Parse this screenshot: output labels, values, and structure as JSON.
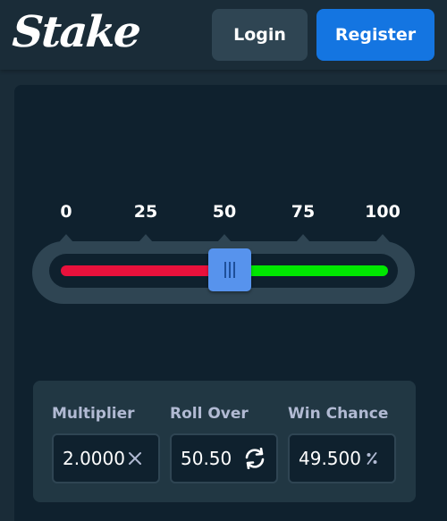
{
  "header": {
    "logo_text": "Stake",
    "login_label": "Login",
    "register_label": "Register"
  },
  "slider": {
    "ticks": [
      "0",
      "25",
      "50",
      "75",
      "100"
    ],
    "value": 50.5,
    "min": 0,
    "max": 100,
    "lose_color": "#e9113c",
    "win_color": "#00e701"
  },
  "controls": {
    "multiplier": {
      "label": "Multiplier",
      "value": "2.0000",
      "icon": "times-icon"
    },
    "roll_over": {
      "label": "Roll Over",
      "value": "50.50",
      "icon": "refresh-icon"
    },
    "win_chance": {
      "label": "Win Chance",
      "value": "49.500",
      "icon": "percent-icon"
    }
  },
  "colors": {
    "background": "#1a2c38",
    "panel": "#0f212e",
    "secondary": "#2f4553",
    "accent": "#1475e1",
    "thumb": "#5793ed"
  }
}
